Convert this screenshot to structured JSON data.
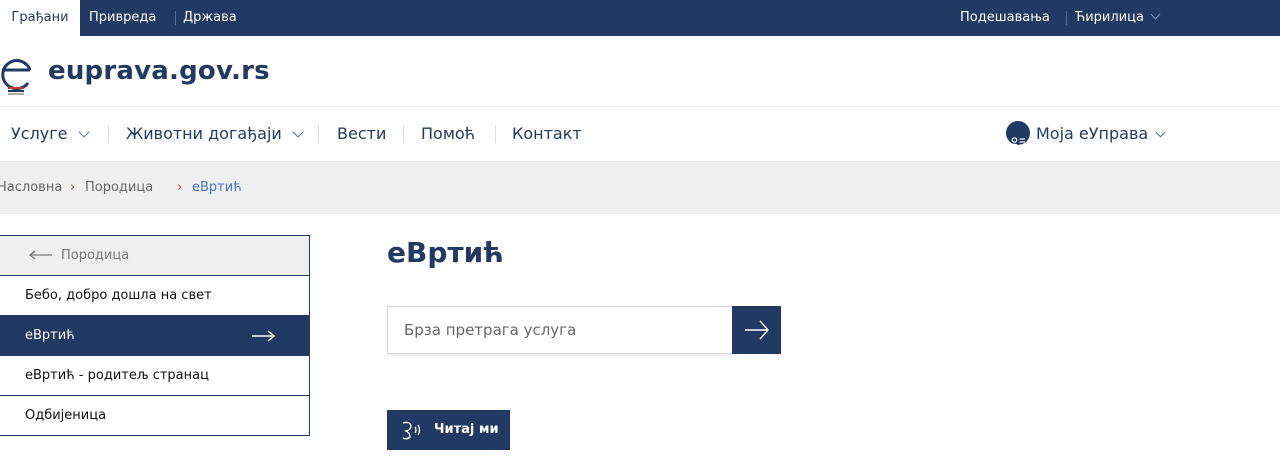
{
  "topbar": {
    "tabs": [
      "Грађани",
      "Привреда",
      "Држава"
    ],
    "settings": "Подешавања",
    "language": "Ћирилица"
  },
  "logo": {
    "text": "euprava.gov.rs"
  },
  "nav": {
    "items": [
      "Услуге",
      "Животни догађаји",
      "Вести",
      "Помоћ",
      "Контакт"
    ],
    "account": "Моја еУправа"
  },
  "breadcrumb": [
    "Насловна",
    "Породица",
    "еВртић"
  ],
  "sidebar": {
    "back": "Породица",
    "items": [
      "Бебо, добро дошла на свет",
      "еВртић",
      "еВртић - родитељ странац",
      "Одбијеница"
    ]
  },
  "main": {
    "title": "еВртић",
    "search_placeholder": "Брза претрага услуга",
    "read_button": "Читај ми"
  },
  "colors": {
    "brand": "#223a63",
    "accent": "#4b73c4",
    "crumb_arrow": "#c0392b"
  }
}
